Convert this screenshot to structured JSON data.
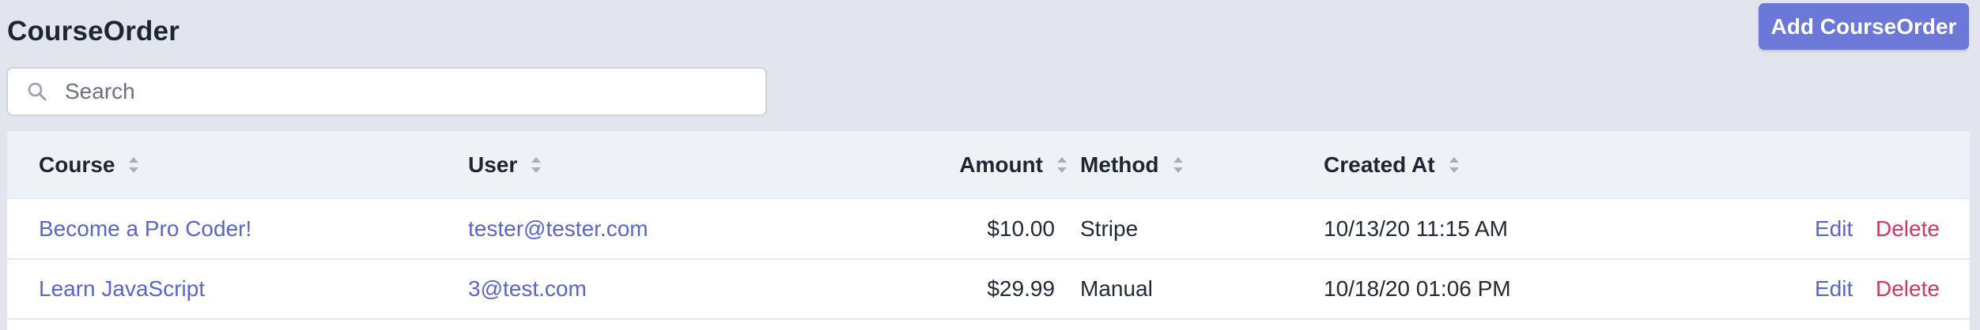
{
  "header": {
    "title": "CourseOrder",
    "add_button_label": "Add CourseOrder"
  },
  "search": {
    "placeholder": "Search",
    "value": ""
  },
  "icons": {
    "search": "search-icon",
    "sort": "sort-icon"
  },
  "colors": {
    "accent": "#6b78d7",
    "link": "#5866cc",
    "danger": "#d4375f",
    "background": "#e2e5ee"
  },
  "table": {
    "columns": [
      "Course",
      "User",
      "Amount",
      "Method",
      "Created At"
    ],
    "rows": [
      {
        "course": "Become a Pro Coder!",
        "user": "tester@tester.com",
        "amount": "$10.00",
        "method": "Stripe",
        "created_at": "10/13/20 11:15 AM",
        "edit": "Edit",
        "delete": "Delete"
      },
      {
        "course": "Learn JavaScript",
        "user": "3@test.com",
        "amount": "$29.99",
        "method": "Manual",
        "created_at": "10/18/20 01:06 PM",
        "edit": "Edit",
        "delete": "Delete"
      }
    ]
  }
}
